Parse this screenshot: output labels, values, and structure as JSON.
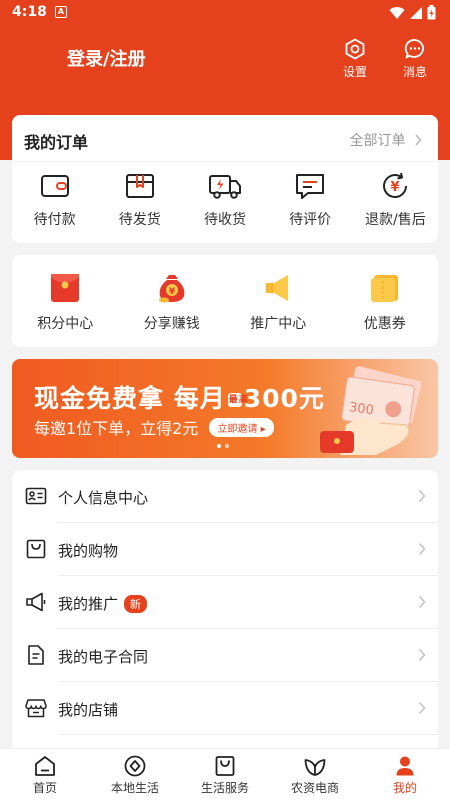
{
  "status": {
    "time": "4:18",
    "sim": "A"
  },
  "header": {
    "login_label": "登录/注册",
    "settings_label": "设置",
    "messages_label": "消息"
  },
  "orders": {
    "title": "我的订单",
    "all_label": "全部订单",
    "items": [
      {
        "label": "待付款",
        "icon": "wallet-icon"
      },
      {
        "label": "待发货",
        "icon": "package-icon"
      },
      {
        "label": "待收货",
        "icon": "truck-icon"
      },
      {
        "label": "待评价",
        "icon": "comment-icon"
      },
      {
        "label": "退款/售后",
        "icon": "refund-icon"
      }
    ]
  },
  "tools": {
    "items": [
      {
        "label": "积分中心",
        "icon": "red-envelope-icon"
      },
      {
        "label": "分享赚钱",
        "icon": "money-bag-icon"
      },
      {
        "label": "推广中心",
        "icon": "megaphone-icon"
      },
      {
        "label": "优惠券",
        "icon": "coupon-icon"
      }
    ]
  },
  "banner": {
    "line1_a": "现金免费拿  每月",
    "tag": "最高",
    "line1_b": "300元",
    "line2": "每邀1位下单，立得2元",
    "invite_label": "立即邀请 ▸",
    "note_text": "300"
  },
  "menu": {
    "items": [
      {
        "label": "个人信息中心",
        "icon": "id-card-icon"
      },
      {
        "label": "我的购物",
        "icon": "shopping-bag-icon"
      },
      {
        "label": "我的推广",
        "icon": "megaphone-outline-icon",
        "badge": "新"
      },
      {
        "label": "我的电子合同",
        "icon": "document-icon"
      },
      {
        "label": "我的店铺",
        "icon": "store-icon"
      }
    ]
  },
  "tabbar": {
    "items": [
      {
        "label": "首页",
        "icon": "home-icon"
      },
      {
        "label": "本地生活",
        "icon": "compass-icon"
      },
      {
        "label": "生活服务",
        "icon": "bag-icon"
      },
      {
        "label": "农资电商",
        "icon": "leaf-icon"
      },
      {
        "label": "我的",
        "icon": "user-icon",
        "active": true
      }
    ]
  },
  "colors": {
    "brand": "#e6411d",
    "background": "#f3f3f3"
  }
}
